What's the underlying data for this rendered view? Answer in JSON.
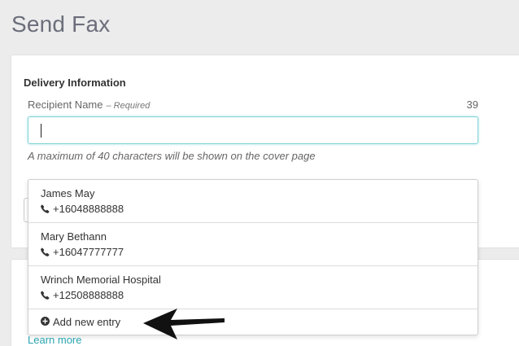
{
  "page": {
    "title": "Send Fax"
  },
  "delivery": {
    "section_title": "Delivery Information",
    "recipient_label": "Recipient Name",
    "required_text": "– Required",
    "char_count": "39",
    "input_value": "",
    "hint": "A maximum of 40 characters will be shown on the cover page"
  },
  "dropdown": {
    "entries": [
      {
        "name": "James May",
        "phone": "+16048888888",
        "icon": "phone-icon"
      },
      {
        "name": "Mary Bethann",
        "phone": "+16047777777",
        "icon": "phone-icon"
      },
      {
        "name": "Wrinch Memorial Hospital",
        "phone": "+12508888888",
        "icon": "phone-icon"
      }
    ],
    "add_new_label": "Add new entry",
    "add_icon": "plus-circle-icon"
  },
  "footer": {
    "learn_more": "Learn more"
  },
  "colors": {
    "accent": "#2aa5b0",
    "input_focus_border": "#7fd3d6",
    "background": "#ececed"
  }
}
